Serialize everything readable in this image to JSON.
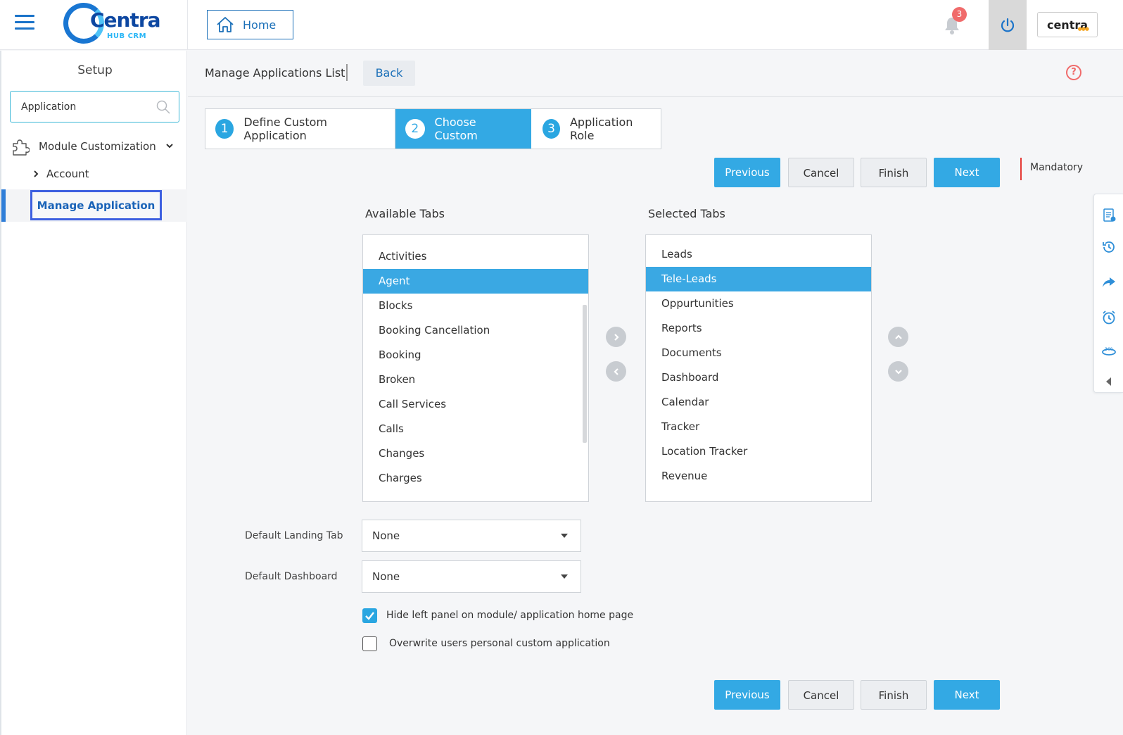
{
  "header": {
    "logo_word": "Centra",
    "logo_sub": "HUB CRM",
    "home_label": "Home",
    "notification_count": "3",
    "brand_label": "centra",
    "brand_dots": "●●●"
  },
  "sidebar": {
    "title": "Setup",
    "search_value": "Application",
    "module_label": "Module Customization",
    "account_label": "Account",
    "active_label": "Manage Application"
  },
  "page": {
    "title": "Manage Applications List",
    "back_label": "Back",
    "help_glyph": "?"
  },
  "steps": [
    {
      "num": "1",
      "label": "Define Custom Application"
    },
    {
      "num": "2",
      "label": "Choose Custom"
    },
    {
      "num": "3",
      "label": "Application Role"
    }
  ],
  "actions": {
    "previous": "Previous",
    "cancel": "Cancel",
    "finish": "Finish",
    "next": "Next",
    "mandatory": "Mandatory"
  },
  "available": {
    "title": "Available Tabs",
    "items": [
      "Activities",
      "Agent",
      "Blocks",
      "Booking Cancellation",
      "Booking",
      "Broken",
      "Call Services",
      "Calls",
      "Changes",
      "Charges"
    ],
    "selected_index": 1
  },
  "selected": {
    "title": "Selected Tabs",
    "items": [
      "Leads",
      "Tele-Leads",
      "Oppurtunities",
      "Reports",
      "Documents",
      "Dashboard",
      "Calendar",
      "Tracker",
      "Location Tracker",
      "Revenue"
    ],
    "selected_index": 1
  },
  "form": {
    "landing_label": "Default Landing Tab",
    "landing_value": "None",
    "dashboard_label": "Default Dashboard",
    "dashboard_value": "None",
    "hide_panel_label": "Hide left panel on module/ application home page",
    "hide_panel_checked": true,
    "overwrite_label": "Overwrite users personal custom application",
    "overwrite_checked": false
  },
  "colors": {
    "accent": "#33a9e4",
    "brand_blue": "#1a6fb8",
    "alert": "#f06b6b"
  },
  "float_icons": [
    "clipboard-icon",
    "history-icon",
    "share-icon",
    "alarm-icon",
    "360-view-icon",
    "collapse-left-icon"
  ]
}
